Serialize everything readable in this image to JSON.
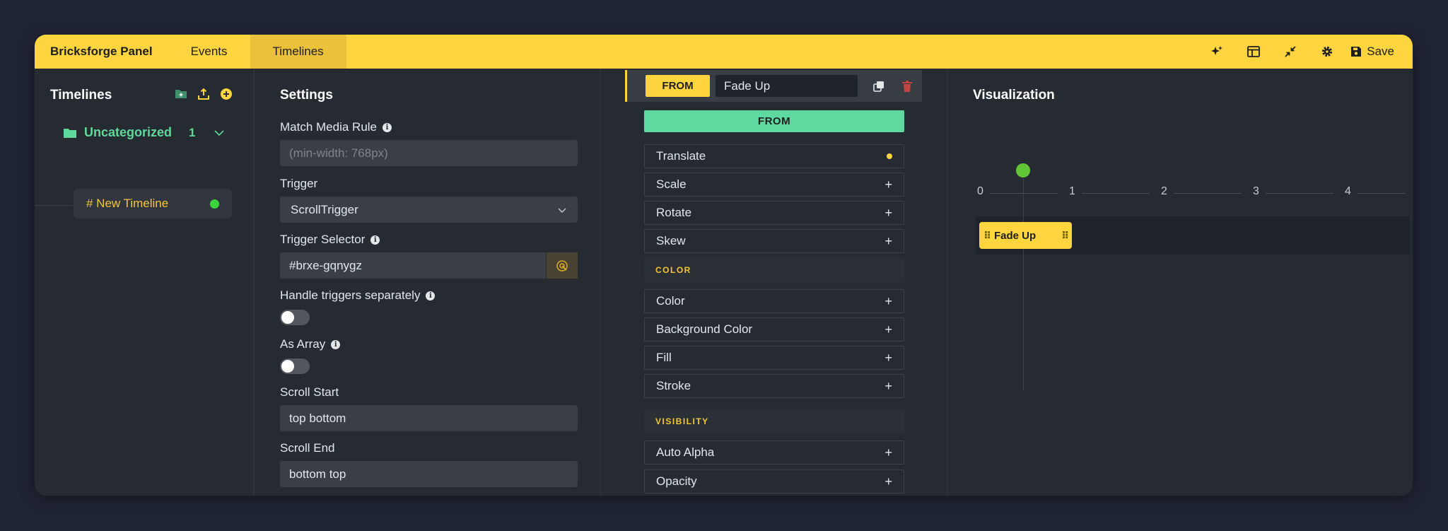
{
  "topbar": {
    "brand": "Bricksforge Panel",
    "tabs": [
      {
        "label": "Events",
        "active": false
      },
      {
        "label": "Timelines",
        "active": true
      }
    ],
    "icons": [
      "sparkles-icon",
      "layout-icon",
      "minimize-icon",
      "gear-icon"
    ],
    "save_label": "Save",
    "accent_color": "#ffd53f"
  },
  "timelines": {
    "title": "Timelines",
    "actions": [
      "add-folder-icon",
      "export-icon",
      "add-circle-icon"
    ],
    "folder": {
      "name": "Uncategorized",
      "count": "1"
    },
    "items": [
      {
        "name": "# New Timeline",
        "status_color": "#3bd43b"
      }
    ]
  },
  "settings": {
    "title": "Settings",
    "match_media_rule": {
      "label": "Match Media Rule",
      "placeholder": "(min-width: 768px)"
    },
    "trigger": {
      "label": "Trigger",
      "value": "ScrollTrigger"
    },
    "trigger_selector": {
      "label": "Trigger Selector",
      "value": "#brxe-gqnygz"
    },
    "handle_triggers": {
      "label": "Handle triggers separately",
      "enabled": false
    },
    "as_array": {
      "label": "As Array",
      "enabled": false
    },
    "scroll_start": {
      "label": "Scroll Start",
      "value": "top bottom"
    },
    "scroll_end": {
      "label": "Scroll End",
      "value": "bottom top"
    }
  },
  "props": {
    "mode_badge": "FROM",
    "animation_name": "Fade Up",
    "strip_label": "FROM",
    "transform": [
      {
        "label": "Translate",
        "marker": "dot"
      },
      {
        "label": "Scale",
        "marker": "+"
      },
      {
        "label": "Rotate",
        "marker": "+"
      },
      {
        "label": "Skew",
        "marker": "+"
      }
    ],
    "color_section": "COLOR",
    "color": [
      {
        "label": "Color",
        "marker": "+"
      },
      {
        "label": "Background Color",
        "marker": "+"
      },
      {
        "label": "Fill",
        "marker": "+"
      },
      {
        "label": "Stroke",
        "marker": "+"
      }
    ],
    "visibility_section": "VISIBILITY",
    "visibility": [
      {
        "label": "Auto Alpha",
        "marker": "+"
      },
      {
        "label": "Opacity",
        "marker": "+"
      }
    ]
  },
  "visualization": {
    "title": "Visualization",
    "ticks": [
      "0",
      "1",
      "2",
      "3",
      "4"
    ],
    "clip_label": "Fade Up"
  }
}
